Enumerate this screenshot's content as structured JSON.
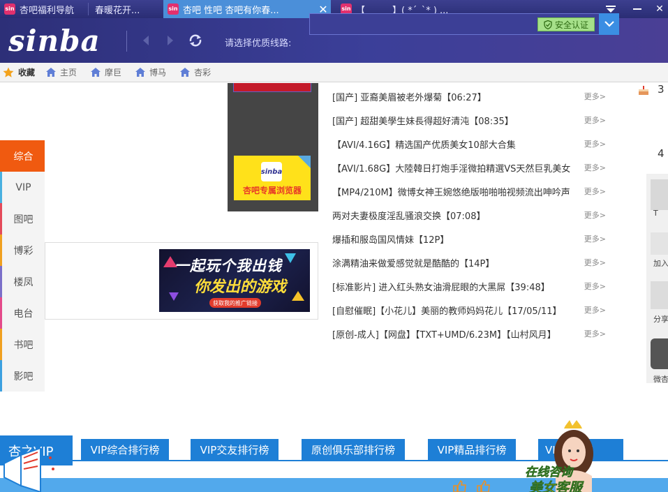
{
  "tabs": [
    {
      "label": "杏吧福利导航",
      "favicon": "sinba"
    },
    {
      "label": "春暖花开...",
      "favicon": ""
    },
    {
      "label": "杏吧 性吧 杏吧有你春...",
      "favicon": "sinba",
      "active": true
    },
    {
      "label": "【　　　】( *´_`* ) ...",
      "favicon": "sinba"
    }
  ],
  "toolbar": {
    "logo": "sinba",
    "route_label": "请选择优质线路:",
    "safe_badge": "安全认证"
  },
  "bookmarks": {
    "favorites_label": "收藏",
    "items": [
      "主页",
      "摩巨",
      "博马",
      "杏彩"
    ]
  },
  "sidenav": [
    "综合",
    "VIP",
    "图吧",
    "博彩",
    "楼凤",
    "电台",
    "书吧",
    "影吧"
  ],
  "ads": {
    "sinba_mini": "sinba",
    "browser_caption": "杏吧专属浏览器",
    "game_line1": "一起玩个我出钱",
    "game_line2": "你发出的游戏",
    "game_button": "获取我的推广链接"
  },
  "news": [
    {
      "title": "[国产] 亚裔美眉被老外爆菊【06:27】",
      "more": "更多>"
    },
    {
      "title": "[国产] 超甜美學生妹長得超好清沌【08:35】",
      "more": "更多>"
    },
    {
      "title": "【AVI/4.16G】精选国产优质美女10部大合集",
      "more": "更多>"
    },
    {
      "title": "【AVI/1.68G】大陸韓日打炮手淫微拍精選VS天然巨乳美女",
      "more": "更多>"
    },
    {
      "title": "【MP4/210M】微博女神王婉悠绝版啪啪啪视频流出呻吟声",
      "more": "更多>"
    },
    {
      "title": "两对夫妻极度淫乱骚浪交换【07:08】",
      "more": "更多>"
    },
    {
      "title": "爆插和服岛国风情妹【12P】",
      "more": "更多>"
    },
    {
      "title": "涂满精油来做爱感觉就是酷酷的【14P】",
      "more": "更多>"
    },
    {
      "title": "[标准影片] 进入红头熟女油滑屁眼的大黑屌【39:48】",
      "more": "更多>"
    },
    {
      "title": "[自慰催眠]【小花儿】美丽的教师妈妈花儿【17/05/11】",
      "more": "更多>"
    },
    {
      "title": "[原创-成人]【网盘】【TXT+UMD/6.23M】【山村风月】",
      "more": "更多>"
    }
  ],
  "right_sidebar": {
    "num1": "3",
    "num2": "4",
    "labels": [
      "T",
      "加入",
      "分享",
      "微杏"
    ]
  },
  "vip": {
    "main": "杏之VIP",
    "tabs": [
      "VIP综合排行榜",
      "VIP交友排行榜",
      "原创俱乐部排行榜",
      "VIP精品排行榜",
      "VIP排行榜"
    ]
  },
  "cs_ad": {
    "line1": "在线咨询",
    "line2": "美女客服"
  },
  "colors": {
    "toolbar": "#2d2f78",
    "accent_orange": "#f05a10",
    "vip_blue": "#1e7fd6",
    "safe_green": "#a6e08a"
  }
}
